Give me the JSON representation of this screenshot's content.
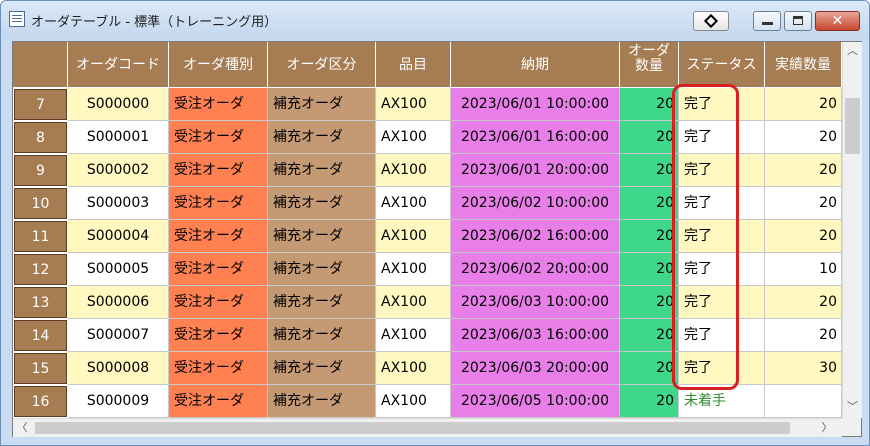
{
  "window": {
    "title": "オーダテーブル - 標準（トレーニング用）",
    "close_symbol": "✕"
  },
  "colors": {
    "header_bg": "#a67c52",
    "row_yellow": "#fff8c0",
    "row_white": "#ffffff",
    "order_type_bg": "#ff8050",
    "category_bg": "#c49a74",
    "due_date_bg": "#e87ee8",
    "quantity_bg": "#3fd78a",
    "status_unstarted_text": "#2e8b2e",
    "highlight": "#d91f1f"
  },
  "grid": {
    "columns": [
      "",
      "オーダコード",
      "オーダ種別",
      "オーダ区分",
      "品目",
      "納期",
      "オーダ\n数量",
      "ステータス",
      "実績数量"
    ],
    "rows": [
      {
        "no": "7",
        "code": "S000000",
        "type": "受注オーダ",
        "category": "補充オーダ",
        "item": "AX100",
        "due": "2023/06/01 10:00:00",
        "qty": "20",
        "status": "完了",
        "actual": "20"
      },
      {
        "no": "8",
        "code": "S000001",
        "type": "受注オーダ",
        "category": "補充オーダ",
        "item": "AX100",
        "due": "2023/06/01 16:00:00",
        "qty": "20",
        "status": "完了",
        "actual": "20"
      },
      {
        "no": "9",
        "code": "S000002",
        "type": "受注オーダ",
        "category": "補充オーダ",
        "item": "AX100",
        "due": "2023/06/01 20:00:00",
        "qty": "20",
        "status": "完了",
        "actual": "20"
      },
      {
        "no": "10",
        "code": "S000003",
        "type": "受注オーダ",
        "category": "補充オーダ",
        "item": "AX100",
        "due": "2023/06/02 10:00:00",
        "qty": "20",
        "status": "完了",
        "actual": "20"
      },
      {
        "no": "11",
        "code": "S000004",
        "type": "受注オーダ",
        "category": "補充オーダ",
        "item": "AX100",
        "due": "2023/06/02 16:00:00",
        "qty": "20",
        "status": "完了",
        "actual": "20"
      },
      {
        "no": "12",
        "code": "S000005",
        "type": "受注オーダ",
        "category": "補充オーダ",
        "item": "AX100",
        "due": "2023/06/02 20:00:00",
        "qty": "20",
        "status": "完了",
        "actual": "10"
      },
      {
        "no": "13",
        "code": "S000006",
        "type": "受注オーダ",
        "category": "補充オーダ",
        "item": "AX100",
        "due": "2023/06/03 10:00:00",
        "qty": "20",
        "status": "完了",
        "actual": "20"
      },
      {
        "no": "14",
        "code": "S000007",
        "type": "受注オーダ",
        "category": "補充オーダ",
        "item": "AX100",
        "due": "2023/06/03 16:00:00",
        "qty": "20",
        "status": "完了",
        "actual": "20"
      },
      {
        "no": "15",
        "code": "S000008",
        "type": "受注オーダ",
        "category": "補充オーダ",
        "item": "AX100",
        "due": "2023/06/03 20:00:00",
        "qty": "20",
        "status": "完了",
        "actual": "30"
      },
      {
        "no": "16",
        "code": "S000009",
        "type": "受注オーダ",
        "category": "補充オーダ",
        "item": "AX100",
        "due": "2023/06/05 10:00:00",
        "qty": "20",
        "status": "未着手",
        "actual": ""
      }
    ]
  }
}
